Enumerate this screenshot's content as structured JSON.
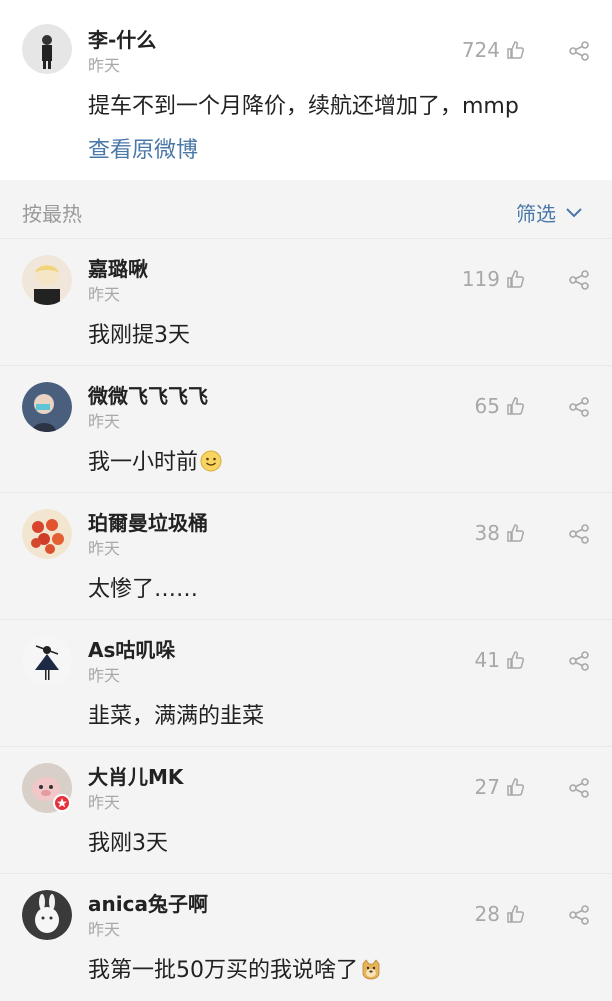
{
  "post": {
    "username": "李-什么",
    "time": "昨天",
    "likes": "724",
    "content": "提车不到一个月降价，续航还增加了，mmp",
    "link": "查看原微博"
  },
  "sortbar": {
    "label": "按最热",
    "filter": "筛选"
  },
  "comments": [
    {
      "username": "嘉璐啾",
      "time": "昨天",
      "likes": "119",
      "content": "我刚提3天"
    },
    {
      "username": "微微飞飞飞飞",
      "time": "昨天",
      "likes": "65",
      "content": "我一小时前"
    },
    {
      "username": "珀爾曼垃圾桶",
      "time": "昨天",
      "likes": "38",
      "content": "太惨了……"
    },
    {
      "username": "As咕叽哚",
      "time": "昨天",
      "likes": "41",
      "content": "韭菜，满满的韭菜"
    },
    {
      "username": "大肖儿MK",
      "time": "昨天",
      "likes": "27",
      "content": "我刚3天"
    },
    {
      "username": "anica兔子啊",
      "time": "昨天",
      "likes": "28",
      "content": "我第一批50万买的我说啥了"
    }
  ],
  "colors": {
    "link": "#4a78a8",
    "muted": "#a8a8a8",
    "background": "#f4f4f4"
  },
  "icons": {
    "like": "thumbs-up-icon",
    "share": "share-icon",
    "filter": "chevron-down-icon",
    "smile": "smile-emoji-icon",
    "doge": "doge-emoji-icon"
  }
}
